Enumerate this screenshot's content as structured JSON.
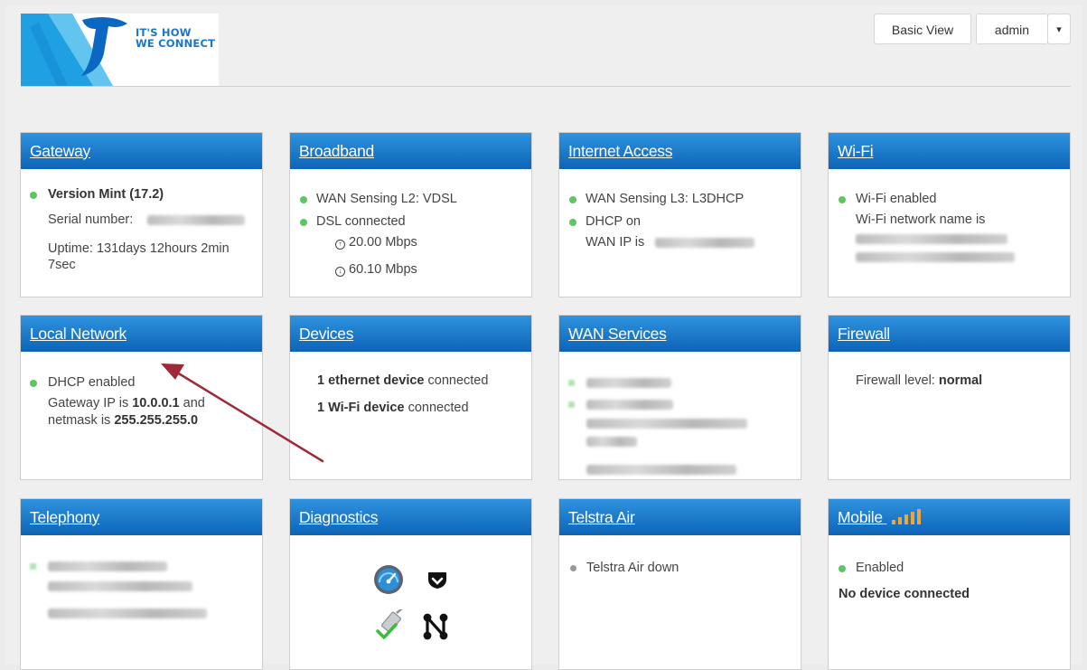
{
  "header": {
    "logo_line1": "IT'S HOW",
    "logo_line2": "WE CONNECT",
    "basic_view": "Basic View",
    "user": "admin",
    "caret": "▾"
  },
  "colors": {
    "brand_blue": "#0c64b6",
    "accent_green": "#5cc760",
    "arrow": "#a02838"
  },
  "gateway": {
    "title": "Gateway",
    "version": "Version Mint (17.2)",
    "serial_label": "Serial number:",
    "uptime_1": "Uptime: 131days 12hours 2min",
    "uptime_2": "7sec"
  },
  "broadband": {
    "title": "Broadband",
    "wan_sensing": "WAN Sensing L2: VDSL",
    "dsl": "DSL connected",
    "upload": "20.00 Mbps",
    "download": "60.10 Mbps"
  },
  "internet": {
    "title": "Internet Access",
    "wan_sensing": "WAN Sensing L3: L3DHCP",
    "dhcp": "DHCP on",
    "wan_ip_label": "WAN IP is"
  },
  "wifi": {
    "title": "Wi-Fi",
    "enabled": "Wi-Fi enabled",
    "network_label": "Wi-Fi network name is"
  },
  "local": {
    "title": "Local Network",
    "dhcp": "DHCP enabled",
    "gw_prefix": "Gateway IP is ",
    "gw_ip": "10.0.0.1",
    "gw_suffix": " and",
    "mask_prefix": "netmask is ",
    "mask": "255.255.255.0"
  },
  "devices": {
    "title": "Devices",
    "eth_count": "1 ethernet device",
    "wifi_count": "1 Wi-Fi device",
    "connected": " connected"
  },
  "wan_services": {
    "title": "WAN Services"
  },
  "firewall": {
    "title": "Firewall",
    "level_label": "Firewall level: ",
    "level": "normal"
  },
  "telephony": {
    "title": "Telephony"
  },
  "diagnostics": {
    "title": "Diagnostics"
  },
  "telstra_air": {
    "title": "Telstra Air",
    "status": "Telstra Air down"
  },
  "mobile": {
    "title": "Mobile",
    "enabled": "Enabled",
    "no_device": "No device connected",
    "signal_bars": 5
  }
}
